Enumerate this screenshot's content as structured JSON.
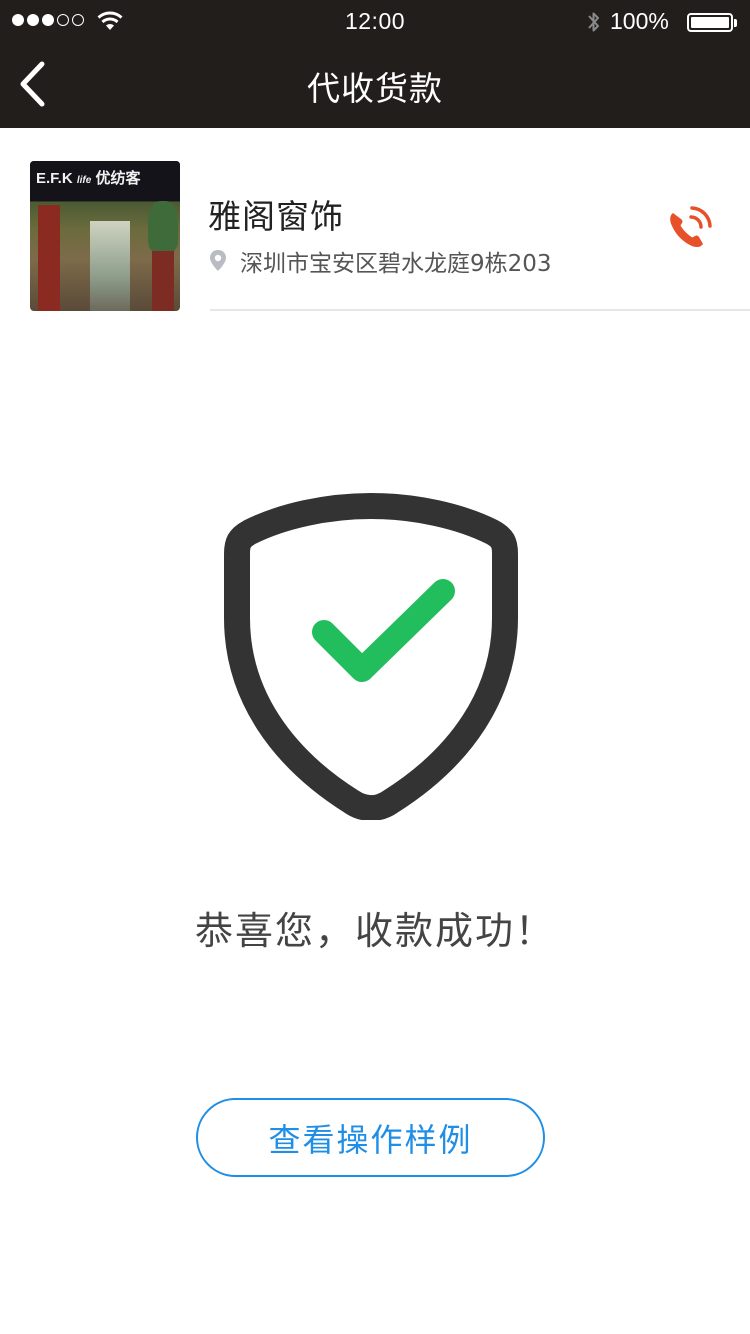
{
  "status_bar": {
    "signal_dots_filled": 3,
    "signal_dots_total": 5,
    "time": "12:00",
    "battery_percent": "100%",
    "battery_level": 1.0,
    "icons": [
      "wifi-icon",
      "bluetooth-icon",
      "battery-icon"
    ]
  },
  "nav": {
    "back_icon": "chevron-left-icon",
    "title": "代收货款"
  },
  "store": {
    "thumbnail_sign": "E.F.K",
    "thumbnail_sign_life": "life",
    "thumbnail_sign_cn": "优纺客",
    "name": "雅阁窗饰",
    "address_icon": "location-pin-icon",
    "address": "深圳市宝安区碧水龙庭9栋203",
    "phone_icon": "phone-icon"
  },
  "result": {
    "icon": "shield-check-icon",
    "message": "恭喜您，收款成功！"
  },
  "actions": {
    "example_label": "查看操作样例"
  },
  "colors": {
    "topbar_bg": "#221e1b",
    "accent_blue": "#1f8ee6",
    "success_green": "#22bd5c",
    "phone_orange": "#e8502a",
    "shield_dark": "#333333"
  }
}
